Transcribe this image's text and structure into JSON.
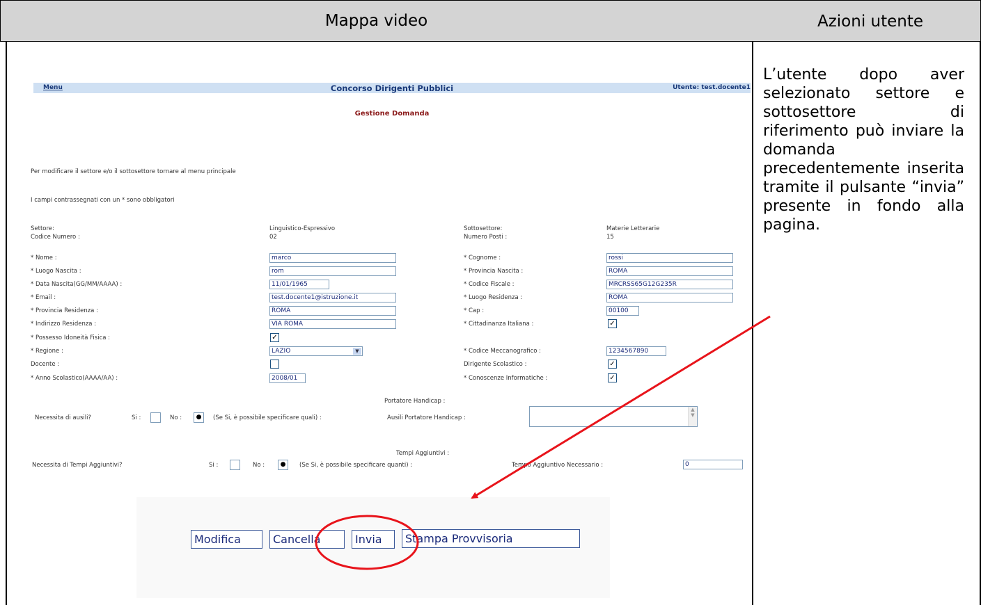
{
  "table": {
    "header_left": "Mappa video",
    "header_right": "Azioni utente",
    "description": "L’utente dopo aver selezionato settore e sottosettore di riferimento può inviare la domanda precedentemente inserita tramite il pulsante “invia” presente in fondo alla pagina."
  },
  "app": {
    "menu_link": "Menu",
    "title": "Concorso Dirigenti Pubblici",
    "user": "Utente: test.docente1",
    "subtitle": "Gestione Domanda",
    "info_sector": "Per modificare il settore e/o il sottosettore tornare al menu principale",
    "info_required": "I campi contrassegnati con un * sono obbligatori",
    "settore_label": "Settore:",
    "settore_value": "Linguistico-Espressivo",
    "codice_numero_label": "Codice Numero :",
    "codice_numero_value": "02",
    "sottosettore_label": "Sottosettore:",
    "sottosettore_value": "Materie Letterarie",
    "numero_posti_label": "Numero Posti :",
    "numero_posti_value": "15",
    "fields": {
      "nome_label": "* Nome :",
      "nome_value": "marco",
      "cognome_label": "* Cognome :",
      "cognome_value": "rossi",
      "luogo_nascita_label": "* Luogo Nascita :",
      "luogo_nascita_value": "rom",
      "provincia_nascita_label": "* Provincia Nascita :",
      "provincia_nascita_value": "ROMA",
      "data_nascita_label": "* Data Nascita(GG/MM/AAAA) :",
      "data_nascita_value": "11/01/1965",
      "codice_fiscale_label": "* Codice Fiscale :",
      "codice_fiscale_value": "MRCRSS65G12G235R",
      "email_label": "* Email :",
      "email_value": "test.docente1@istruzione.it",
      "luogo_residenza_label": "* Luogo Residenza :",
      "luogo_residenza_value": "ROMA",
      "provincia_residenza_label": "* Provincia Residenza :",
      "provincia_residenza_value": "ROMA",
      "cap_label": "* Cap :",
      "cap_value": "00100",
      "indirizzo_label": "* Indirizzo Residenza :",
      "indirizzo_value": "VIA ROMA",
      "cittadinanza_label": "* Cittadinanza Italiana :",
      "idoneita_label": "* Possesso Idoneità Fisica :",
      "regione_label": "* Regione :",
      "regione_value": "LAZIO",
      "codice_mecc_label": "* Codice Meccanografico :",
      "codice_mecc_value": "1234567890",
      "docente_label": "Docente :",
      "dirigente_label": "Dirigente Scolastico :",
      "anno_label": "* Anno Scolastico(AAAA/AA) :",
      "anno_value": "2008/01",
      "conoscenze_label": "* Conoscenze Informatiche :"
    },
    "handicap": {
      "title": "Portatore Handicap :",
      "question": "Necessita di ausili?",
      "si": "Si :",
      "no": "No :",
      "hint": "(Se Si, è possibile specificare quali) :",
      "ausili_label": "Ausili Portatore Handicap :"
    },
    "tempi": {
      "title": "Tempi Aggiuntivi :",
      "question": "Necessita di Tempi Aggiuntivi?",
      "si": "Si :",
      "no": "No :",
      "hint": "(Se Si, è possibile specificare quanti) :",
      "tempo_label": "Tempo Aggiuntivo Necessario :",
      "tempo_value": "0"
    },
    "buttons": {
      "modifica": "Modifica",
      "cancella": "Cancella",
      "invia": "Invia",
      "stampa": "Stampa Provvisoria"
    }
  },
  "colors": {
    "annotation": "#e8141b",
    "topbar": "#cfe0f3",
    "header_bg": "#d4d4d4"
  }
}
